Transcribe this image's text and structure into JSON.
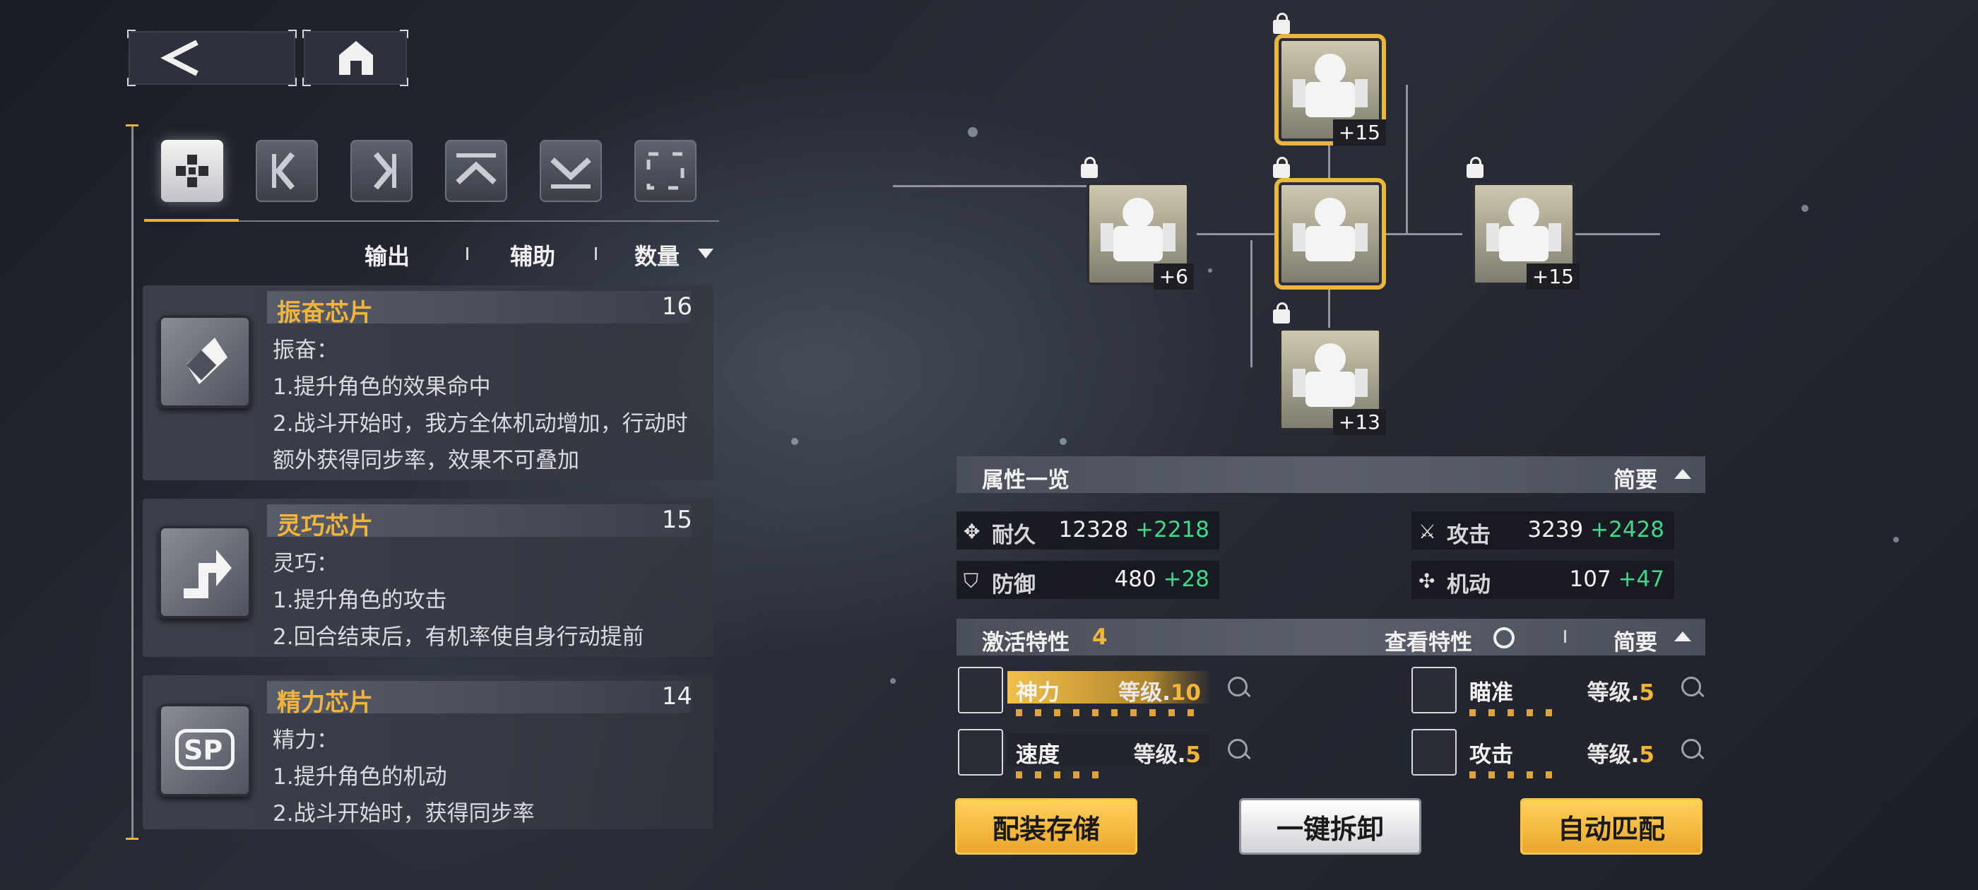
{
  "nav": {
    "back_icon": "back-arrow-icon",
    "home_icon": "home-icon"
  },
  "filters": [
    {
      "name": "all-filter-icon",
      "active": true
    },
    {
      "name": "left-bracket-filter-icon",
      "active": false
    },
    {
      "name": "right-bracket-filter-icon",
      "active": false
    },
    {
      "name": "up-chevron-filter-icon",
      "active": false
    },
    {
      "name": "down-chevron-filter-icon",
      "active": false
    },
    {
      "name": "frame-filter-icon",
      "active": false
    }
  ],
  "sort": {
    "output": "输出",
    "support": "辅助",
    "quantity": "数量"
  },
  "chips": [
    {
      "title": "振奋芯片",
      "count": "16",
      "lines": [
        "振奋：",
        "1.提升角色的效果命中",
        "2.战斗开始时，我方全体机动增加，行动时",
        "额外获得同步率，效果不可叠加"
      ]
    },
    {
      "title": "灵巧芯片",
      "count": "15",
      "lines": [
        "灵巧：",
        "1.提升角色的攻击",
        "2.回合结束后，有机率使自身行动提前"
      ]
    },
    {
      "title": "精力芯片",
      "count": "14",
      "icon_text": "SP",
      "lines": [
        "精力：",
        "1.提升角色的机动",
        "2.战斗开始时，获得同步率"
      ]
    }
  ],
  "modules": {
    "top": "+15",
    "left": "+6",
    "right": "+15",
    "bottom": "+13"
  },
  "attributes": {
    "header": "属性一览",
    "toggle": "简要",
    "durability": {
      "label": "耐久",
      "base": "12328",
      "bonus": "+2218"
    },
    "attack": {
      "label": "攻击",
      "base": "3239",
      "bonus": "+2428"
    },
    "defense": {
      "label": "防御",
      "base": "480",
      "bonus": "+28"
    },
    "mobility": {
      "label": "机动",
      "base": "107",
      "bonus": "+47"
    }
  },
  "traits": {
    "header": "激活特性",
    "count": "4",
    "view": "查看特性",
    "toggle": "简要",
    "level_label": "等级.",
    "items": [
      {
        "name": "神力",
        "level": "10"
      },
      {
        "name": "瞄准",
        "level": "5"
      },
      {
        "name": "速度",
        "level": "5"
      },
      {
        "name": "攻击",
        "level": "5"
      }
    ]
  },
  "buttons": {
    "save": "配装存储",
    "unequip": "一键拆卸",
    "auto": "自动匹配"
  },
  "colors": {
    "accent": "#f2b43a",
    "bonus": "#3fd88c"
  }
}
